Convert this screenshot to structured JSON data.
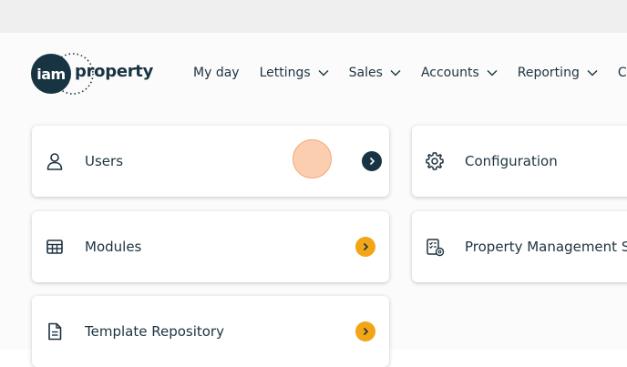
{
  "logo": {
    "badge_text": "iam",
    "word": "property"
  },
  "nav": {
    "items": [
      {
        "label": "My day",
        "has_dropdown": false
      },
      {
        "label": "Lettings",
        "has_dropdown": true
      },
      {
        "label": "Sales",
        "has_dropdown": true
      },
      {
        "label": "Accounts",
        "has_dropdown": true
      },
      {
        "label": "Reporting",
        "has_dropdown": true
      },
      {
        "label": "Cor",
        "has_dropdown": false
      }
    ]
  },
  "cards": {
    "users": {
      "label": "Users",
      "icon": "user-icon",
      "arrow_color": "#183442"
    },
    "configuration": {
      "label": "Configuration",
      "icon": "gear-icon"
    },
    "modules": {
      "label": "Modules",
      "icon": "modules-icon",
      "arrow_color": "#f2a516"
    },
    "property_management": {
      "label": "Property Management Se",
      "icon": "checklist-gear-icon"
    },
    "template_repository": {
      "label": "Template Repository",
      "icon": "document-icon",
      "arrow_color": "#f2a516"
    }
  },
  "colors": {
    "brand_dark": "#183442",
    "accent_orange": "#f2a516",
    "text": "#1d3340"
  }
}
